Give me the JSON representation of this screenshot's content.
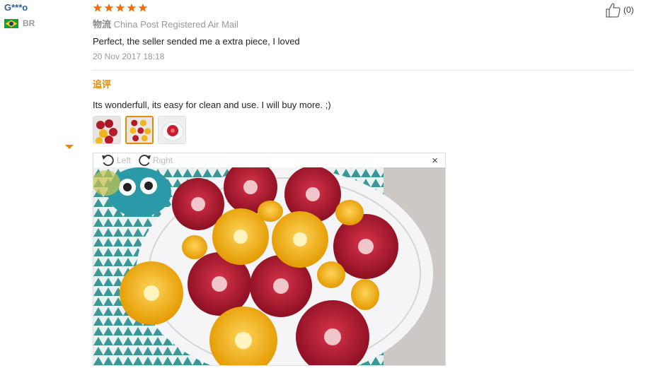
{
  "reviewer": {
    "name": "G***o",
    "country_code": "BR"
  },
  "rating": {
    "stars": 5,
    "max": 5,
    "color": "#ff6a00"
  },
  "logistics": {
    "label": "物流",
    "value": "China Post Registered Air Mail"
  },
  "review": {
    "text": "Perfect, the seller sended me a extra piece, I loved",
    "date": "20 Nov 2017 18:18"
  },
  "followup": {
    "label": "追评",
    "text": "Its wonderfull, its easy for clean and use. I will buy more. ;)"
  },
  "viewer": {
    "left_label": "Left",
    "right_label": "Right",
    "close_symbol": "×"
  },
  "helpful": {
    "count_text": "(0)"
  },
  "icons": {
    "like": "thumbs-up-icon",
    "rotate_left": "rotate-left-icon",
    "rotate_right": "rotate-right-icon",
    "close": "close-icon",
    "flag": "brazil-flag-icon"
  }
}
